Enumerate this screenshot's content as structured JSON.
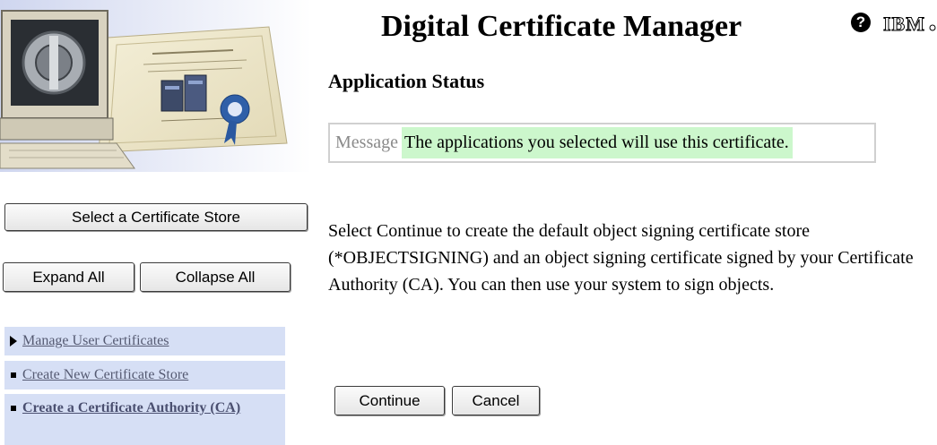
{
  "header": {
    "title": "Digital Certificate Manager",
    "help_icon": "?",
    "logo_text": "IBM"
  },
  "sidebar": {
    "select_store_label": "Select a Certificate Store",
    "expand_all_label": "Expand All",
    "collapse_all_label": "Collapse All",
    "nav_items": [
      {
        "label": "Manage User Certificates",
        "marker": "triangle-right"
      },
      {
        "label": "Create New Certificate Store",
        "marker": "square"
      },
      {
        "label": "Create a Certificate Authority (CA)",
        "marker": "square"
      }
    ]
  },
  "main": {
    "section_title": "Application Status",
    "message_label": "Message",
    "message_text": "The applications you selected will use this certificate.",
    "body_text": "Select Continue to create the default object signing certificate store (*OBJECTSIGNING) and an object signing certificate signed by your Certificate Authority (CA). You can then use your system to sign objects.",
    "continue_label": "Continue",
    "cancel_label": "Cancel"
  },
  "colors": {
    "nav_background": "#d6dff5",
    "message_highlight": "#ccf7cc",
    "link_color": "#555a72"
  }
}
